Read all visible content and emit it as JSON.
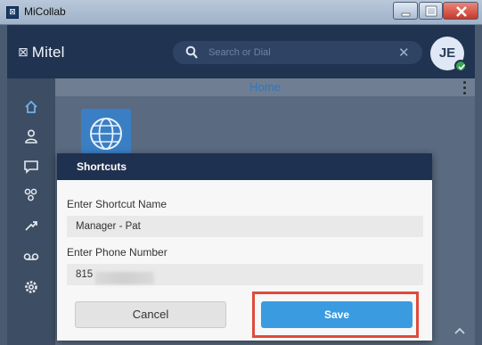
{
  "window": {
    "title": "MiCollab",
    "app_icon": "micollab-icon"
  },
  "header": {
    "logo_text": "Mitel",
    "search": {
      "placeholder": "Search or Dial",
      "value": ""
    },
    "avatar_initials": "JE",
    "presence_status": "available"
  },
  "sidebar": {
    "items": [
      {
        "icon": "home-icon"
      },
      {
        "icon": "person-icon"
      },
      {
        "icon": "chat-icon"
      },
      {
        "icon": "contacts-icon"
      },
      {
        "icon": "call-history-icon"
      },
      {
        "icon": "voicemail-icon"
      },
      {
        "icon": "settings-icon"
      }
    ]
  },
  "main": {
    "title": "Home"
  },
  "dialog": {
    "title": "Shortcuts",
    "name_label": "Enter Shortcut Name",
    "name_value": "Manager - Pat",
    "phone_label": "Enter Phone Number",
    "phone_value": "815",
    "cancel_label": "Cancel",
    "save_label": "Save"
  },
  "colors": {
    "header_bg": "#203351",
    "accent_blue": "#3a9be0",
    "highlight_red": "#e04a3b",
    "presence_green": "#39a64f"
  }
}
